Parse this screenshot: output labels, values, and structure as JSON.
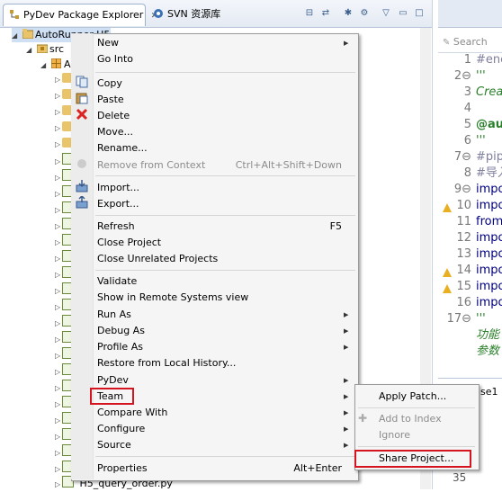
{
  "explorer": {
    "tab_title": "PyDev Package Explorer",
    "tab_close": "✕",
    "svn_tab_title": "SVN 资源库",
    "project_name": "AutoRunner-H5",
    "src_label": "src",
    "package_label": "A",
    "bottom_file": "H5_query_order.py"
  },
  "editor": {
    "search_placeholder": "Search",
    "lines": [
      {
        "num": "1",
        "code": "#enc",
        "color": "#7f7f9f",
        "italic": false,
        "bold": false
      },
      {
        "num": "2⊖",
        "code": "'''",
        "color": "#2a7f2a",
        "italic": false,
        "bold": false
      },
      {
        "num": "3",
        "code": "Crea",
        "color": "#2a7f2a",
        "italic": true,
        "bold": false
      },
      {
        "num": "4",
        "code": "",
        "color": "#000000",
        "italic": false,
        "bold": false
      },
      {
        "num": "5",
        "code": "@aut",
        "color": "#2a7f2a",
        "italic": false,
        "bold": true
      },
      {
        "num": "6",
        "code": "'''",
        "color": "#2a7f2a",
        "italic": false,
        "bold": false
      },
      {
        "num": "7⊖",
        "code": "#pip",
        "color": "#7f7f9f",
        "italic": false,
        "bold": false
      },
      {
        "num": "8",
        "code": "#导入",
        "color": "#7f7f9f",
        "italic": false,
        "bold": false
      },
      {
        "num": "9⊖",
        "code": "impo",
        "color": "#000080",
        "italic": false,
        "bold": false
      },
      {
        "num": "10",
        "code": "impo",
        "color": "#000080",
        "italic": false,
        "bold": false
      },
      {
        "num": "11",
        "code": "from",
        "color": "#000080",
        "italic": false,
        "bold": false
      },
      {
        "num": "12",
        "code": "impo",
        "color": "#000080",
        "italic": false,
        "bold": false
      },
      {
        "num": "13",
        "code": "impo",
        "color": "#000080",
        "italic": false,
        "bold": false
      },
      {
        "num": "14",
        "code": "impo",
        "color": "#000080",
        "italic": false,
        "bold": false
      },
      {
        "num": "15",
        "code": "impo",
        "color": "#000080",
        "italic": false,
        "bold": false
      },
      {
        "num": "16",
        "code": "impo",
        "color": "#000080",
        "italic": false,
        "bold": false
      },
      {
        "num": "17⊖",
        "code": "'''",
        "color": "#2a7f2a",
        "italic": false,
        "bold": false
      },
      {
        "num": "",
        "code": "功能",
        "color": "#2a7f2a",
        "italic": true,
        "bold": false
      },
      {
        "num": "",
        "code": "参数",
        "color": "#2a7f2a",
        "italic": true,
        "bold": false
      }
    ],
    "console_label": "se1",
    "console_number": "35"
  },
  "menu": {
    "items": [
      {
        "label": "New",
        "shortcut": "",
        "arrow": true,
        "disabled": false
      },
      {
        "label": "Go Into",
        "shortcut": "",
        "arrow": false,
        "disabled": false
      },
      {
        "label": "Copy",
        "shortcut": "",
        "arrow": false,
        "disabled": false
      },
      {
        "label": "Paste",
        "shortcut": "",
        "arrow": false,
        "disabled": false
      },
      {
        "label": "Delete",
        "shortcut": "",
        "arrow": false,
        "disabled": false
      },
      {
        "label": "Move...",
        "shortcut": "",
        "arrow": false,
        "disabled": false
      },
      {
        "label": "Rename...",
        "shortcut": "",
        "arrow": false,
        "disabled": false
      },
      {
        "label": "Remove from Context",
        "shortcut": "Ctrl+Alt+Shift+Down",
        "arrow": false,
        "disabled": true
      },
      {
        "label": "Import...",
        "shortcut": "",
        "arrow": false,
        "disabled": false
      },
      {
        "label": "Export...",
        "shortcut": "",
        "arrow": false,
        "disabled": false
      },
      {
        "label": "Refresh",
        "shortcut": "F5",
        "arrow": false,
        "disabled": false
      },
      {
        "label": "Close Project",
        "shortcut": "",
        "arrow": false,
        "disabled": false
      },
      {
        "label": "Close Unrelated Projects",
        "shortcut": "",
        "arrow": false,
        "disabled": false
      },
      {
        "label": "Validate",
        "shortcut": "",
        "arrow": false,
        "disabled": false
      },
      {
        "label": "Show in Remote Systems view",
        "shortcut": "",
        "arrow": false,
        "disabled": false
      },
      {
        "label": "Run As",
        "shortcut": "",
        "arrow": true,
        "disabled": false
      },
      {
        "label": "Debug As",
        "shortcut": "",
        "arrow": true,
        "disabled": false
      },
      {
        "label": "Profile As",
        "shortcut": "",
        "arrow": true,
        "disabled": false
      },
      {
        "label": "Restore from Local History...",
        "shortcut": "",
        "arrow": false,
        "disabled": false
      },
      {
        "label": "PyDev",
        "shortcut": "",
        "arrow": true,
        "disabled": false
      },
      {
        "label": "Team",
        "shortcut": "",
        "arrow": true,
        "disabled": false
      },
      {
        "label": "Compare With",
        "shortcut": "",
        "arrow": true,
        "disabled": false
      },
      {
        "label": "Configure",
        "shortcut": "",
        "arrow": true,
        "disabled": false
      },
      {
        "label": "Source",
        "shortcut": "",
        "arrow": true,
        "disabled": false
      },
      {
        "label": "Properties",
        "shortcut": "Alt+Enter",
        "arrow": false,
        "disabled": false
      }
    ]
  },
  "team_submenu": {
    "items": [
      {
        "label": "Apply Patch...",
        "disabled": false
      },
      {
        "label": "Add to Index",
        "disabled": true
      },
      {
        "label": "Ignore",
        "disabled": true
      },
      {
        "label": "Share Project...",
        "disabled": false
      }
    ]
  },
  "colors": {
    "highlight": "#d4141e",
    "menu_bg": "#f5f5f5",
    "disabled_text": "#8c8c8c"
  }
}
